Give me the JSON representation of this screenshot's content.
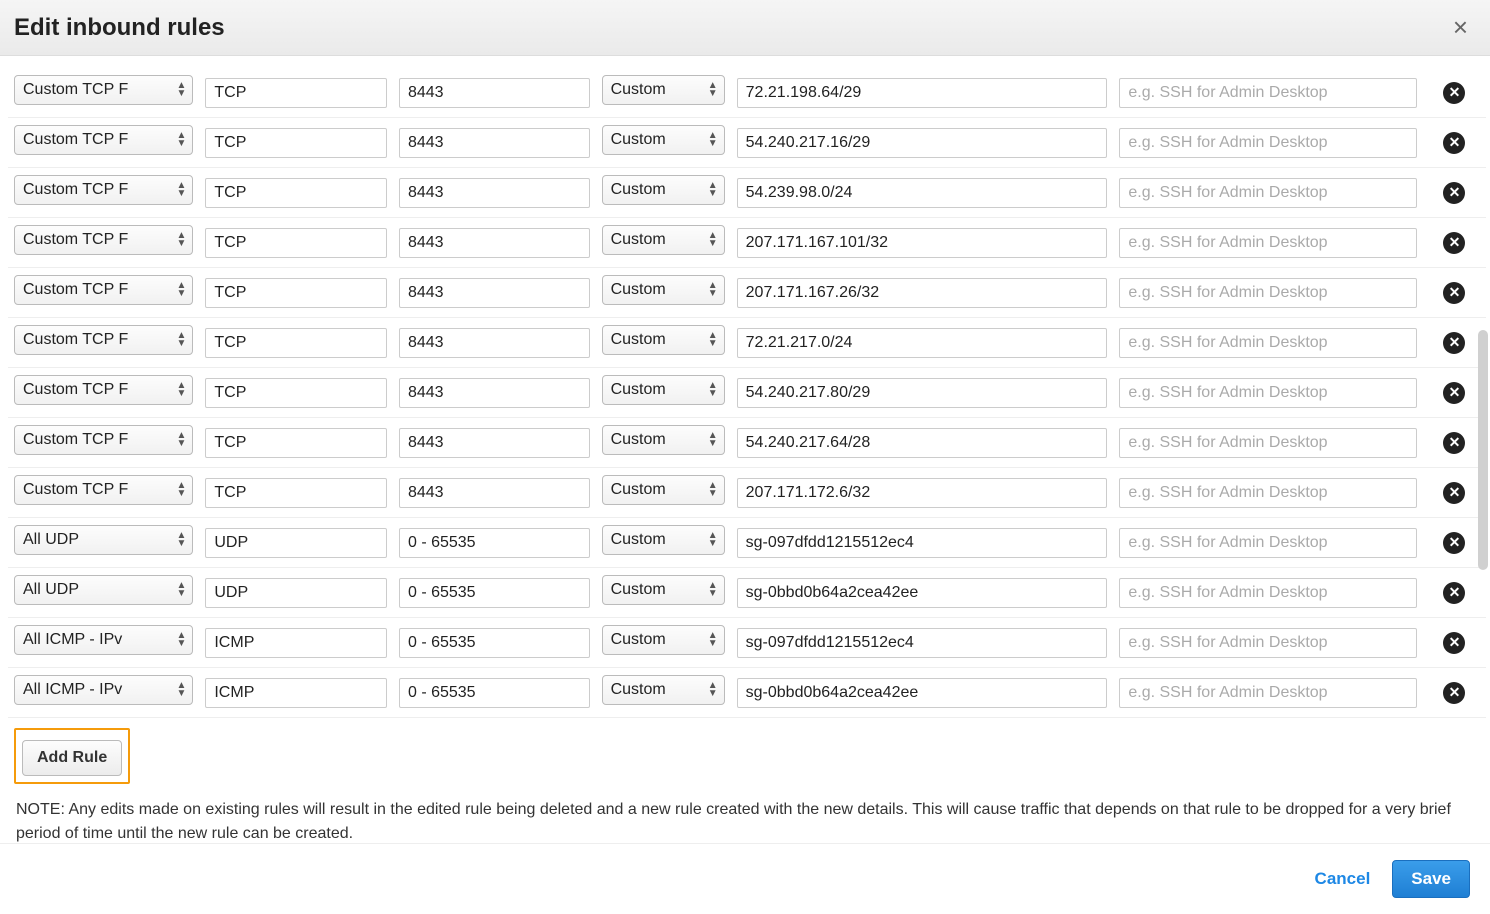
{
  "dialog": {
    "title": "Edit inbound rules",
    "close_icon": "×"
  },
  "placeholders": {
    "description": "e.g. SSH for Admin Desktop"
  },
  "rules": [
    {
      "type": "Custom TCP F",
      "protocol": "TCP",
      "port": "8443",
      "source_sel": "Custom",
      "source": "72.21.198.64/29",
      "description": ""
    },
    {
      "type": "Custom TCP F",
      "protocol": "TCP",
      "port": "8443",
      "source_sel": "Custom",
      "source": "54.240.217.16/29",
      "description": ""
    },
    {
      "type": "Custom TCP F",
      "protocol": "TCP",
      "port": "8443",
      "source_sel": "Custom",
      "source": "54.239.98.0/24",
      "description": ""
    },
    {
      "type": "Custom TCP F",
      "protocol": "TCP",
      "port": "8443",
      "source_sel": "Custom",
      "source": "207.171.167.101/32",
      "description": ""
    },
    {
      "type": "Custom TCP F",
      "protocol": "TCP",
      "port": "8443",
      "source_sel": "Custom",
      "source": "207.171.167.26/32",
      "description": ""
    },
    {
      "type": "Custom TCP F",
      "protocol": "TCP",
      "port": "8443",
      "source_sel": "Custom",
      "source": "72.21.217.0/24",
      "description": ""
    },
    {
      "type": "Custom TCP F",
      "protocol": "TCP",
      "port": "8443",
      "source_sel": "Custom",
      "source": "54.240.217.80/29",
      "description": ""
    },
    {
      "type": "Custom TCP F",
      "protocol": "TCP",
      "port": "8443",
      "source_sel": "Custom",
      "source": "54.240.217.64/28",
      "description": ""
    },
    {
      "type": "Custom TCP F",
      "protocol": "TCP",
      "port": "8443",
      "source_sel": "Custom",
      "source": "207.171.172.6/32",
      "description": ""
    },
    {
      "type": "All UDP",
      "protocol": "UDP",
      "port": "0 - 65535",
      "source_sel": "Custom",
      "source": "sg-097dfdd1215512ec4",
      "description": ""
    },
    {
      "type": "All UDP",
      "protocol": "UDP",
      "port": "0 - 65535",
      "source_sel": "Custom",
      "source": "sg-0bbd0b64a2cea42ee",
      "description": ""
    },
    {
      "type": "All ICMP - IPv",
      "protocol": "ICMP",
      "port": "0 - 65535",
      "source_sel": "Custom",
      "source": "sg-097dfdd1215512ec4",
      "description": ""
    },
    {
      "type": "All ICMP - IPv",
      "protocol": "ICMP",
      "port": "0 - 65535",
      "source_sel": "Custom",
      "source": "sg-0bbd0b64a2cea42ee",
      "description": ""
    }
  ],
  "buttons": {
    "add_rule": "Add Rule",
    "cancel": "Cancel",
    "save": "Save"
  },
  "note": "NOTE: Any edits made on existing rules will result in the edited rule being deleted and a new rule created with the new details. This will cause traffic that depends on that rule to be dropped for a very brief period of time until the new rule can be created."
}
